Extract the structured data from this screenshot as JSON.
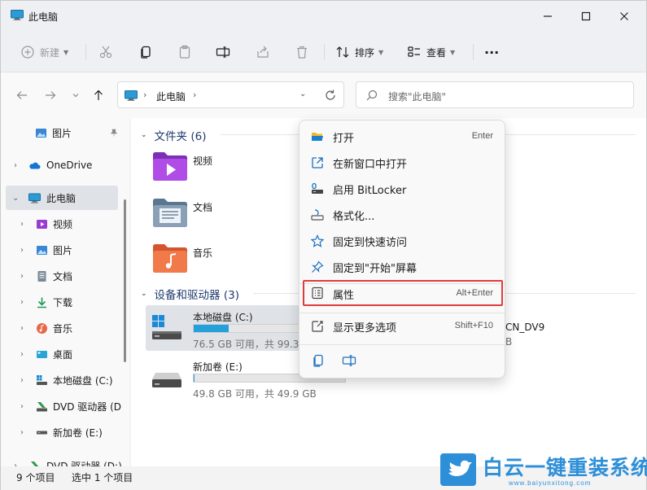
{
  "window": {
    "title": "此电脑"
  },
  "toolbar": {
    "new_label": "新建",
    "sort_label": "排序",
    "view_label": "查看",
    "more_label": "···"
  },
  "address": {
    "location": "此电脑",
    "search_placeholder": "搜索\"此电脑\""
  },
  "sidebar": {
    "items": [
      {
        "label": "图片",
        "icon": "pictures-icon"
      },
      {
        "label": "OneDrive",
        "icon": "cloud-icon"
      },
      {
        "label": "此电脑",
        "icon": "computer-icon"
      },
      {
        "label": "视频",
        "icon": "videos-icon"
      },
      {
        "label": "图片",
        "icon": "pictures-icon"
      },
      {
        "label": "文档",
        "icon": "documents-icon"
      },
      {
        "label": "下载",
        "icon": "downloads-icon"
      },
      {
        "label": "音乐",
        "icon": "music-icon"
      },
      {
        "label": "桌面",
        "icon": "desktop-icon"
      },
      {
        "label": "本地磁盘 (C:)",
        "icon": "drive-c-icon"
      },
      {
        "label": "DVD 驱动器 (D",
        "icon": "dvd-icon"
      },
      {
        "label": "新加卷 (E:)",
        "icon": "drive-icon"
      },
      {
        "label": "DVD 驱动器 (D:)",
        "icon": "dvd-icon"
      }
    ]
  },
  "content": {
    "folders_header": "文件夹 (6)",
    "folders": [
      {
        "name": "视频"
      },
      {
        "name": "文档"
      },
      {
        "name": "音乐"
      }
    ],
    "drives_header": "设备和驱动器 (3)",
    "drives": [
      {
        "name": "本地磁盘 (C:)",
        "info": "76.5 GB 可用，共 99.3",
        "used_fraction": 0.23
      },
      {
        "name": "新加卷 (E:)",
        "info": "49.8 GB 可用，共 49.9 GB",
        "used_fraction": 0.002
      }
    ],
    "peek_label": "CN_DV9",
    "peek_info": "B"
  },
  "context_menu": {
    "items": [
      {
        "label": "打开",
        "shortcut": "Enter",
        "icon": "open-folder-icon"
      },
      {
        "label": "在新窗口中打开",
        "shortcut": "",
        "icon": "external-window-icon"
      },
      {
        "label": "启用 BitLocker",
        "shortcut": "",
        "icon": "bitlocker-key-icon"
      },
      {
        "label": "格式化...",
        "shortcut": "",
        "icon": "format-icon"
      },
      {
        "label": "固定到快速访问",
        "shortcut": "",
        "icon": "star-icon"
      },
      {
        "label": "固定到\"开始\"屏幕",
        "shortcut": "",
        "icon": "pin-icon"
      },
      {
        "label": "属性",
        "shortcut": "Alt+Enter",
        "icon": "properties-icon"
      },
      {
        "label": "显示更多选项",
        "shortcut": "Shift+F10",
        "icon": "more-options-icon"
      }
    ]
  },
  "status": {
    "item_count": "9 个项目",
    "selected_count": "选中 1 个项目"
  },
  "watermark": {
    "title": "白云一键重装系统",
    "url": "www.baiyunxitong.com"
  },
  "colors": {
    "accent": "#26a0da",
    "highlight_border": "#e03c3c",
    "group_header": "#1f3a6e",
    "watermark": "#2d8fd8"
  }
}
